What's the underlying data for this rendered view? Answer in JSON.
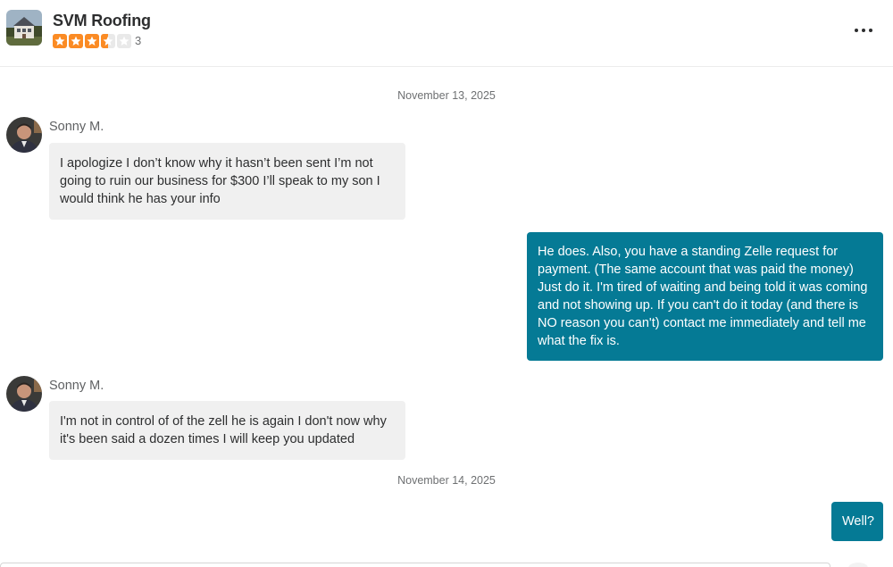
{
  "business": {
    "name": "SVM Roofing",
    "photo_icon": "house-photo",
    "rating": 3.5,
    "rating_max": 5,
    "review_count": "3",
    "accent_color": "#fb8b24",
    "menu_icon": "more-horizontal-icon"
  },
  "conversation": {
    "date_1": "November 13, 2025",
    "message_1": {
      "sender": "Sonny M.",
      "text": "I apologize I don’t know why it hasn’t been sent I’m not going to ruin our business for $300 I’ll speak to my son I would think he has your info"
    },
    "message_2": {
      "text": "He does. Also, you have a standing Zelle request for payment. (The same account that was paid the money) Just do it. I'm tired of waiting and being told it was coming and not showing up. If you can't do it today (and there is NO reason you can't) contact me immediately and tell me what the fix is."
    },
    "message_3": {
      "sender": "Sonny M.",
      "text": "I'm not in control of of the zell he is again I don't now why it's been said a dozen times I will keep you updated"
    },
    "date_2": "November 14, 2025",
    "message_4": {
      "text": "Well?"
    },
    "outgoing_color": "#057a95",
    "incoming_color": "#f0f0f0"
  }
}
